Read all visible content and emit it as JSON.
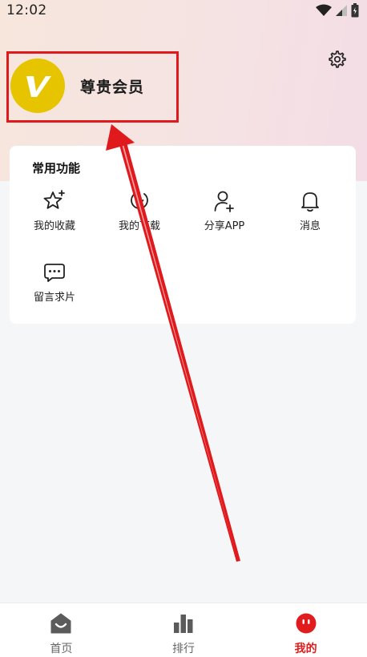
{
  "status_bar": {
    "time": "12:02"
  },
  "profile": {
    "name": "尊贵会员",
    "avatar_letter": "V"
  },
  "features": {
    "section_title": "常用功能",
    "items": [
      {
        "label": "我的收藏",
        "icon": "star-icon"
      },
      {
        "label": "我的下载",
        "icon": "download-icon"
      },
      {
        "label": "分享APP",
        "icon": "share-user-icon"
      },
      {
        "label": "消息",
        "icon": "bell-icon"
      },
      {
        "label": "留言求片",
        "icon": "chat-icon"
      }
    ]
  },
  "tabbar": {
    "tabs": [
      {
        "label": "首页",
        "icon": "home-icon",
        "active": false
      },
      {
        "label": "排行",
        "icon": "ranking-icon",
        "active": false
      },
      {
        "label": "我的",
        "icon": "profile-icon",
        "active": true
      }
    ]
  },
  "colors": {
    "accent": "#e11c1c",
    "avatar": "#e7c400",
    "highlight": "#e0191c"
  }
}
